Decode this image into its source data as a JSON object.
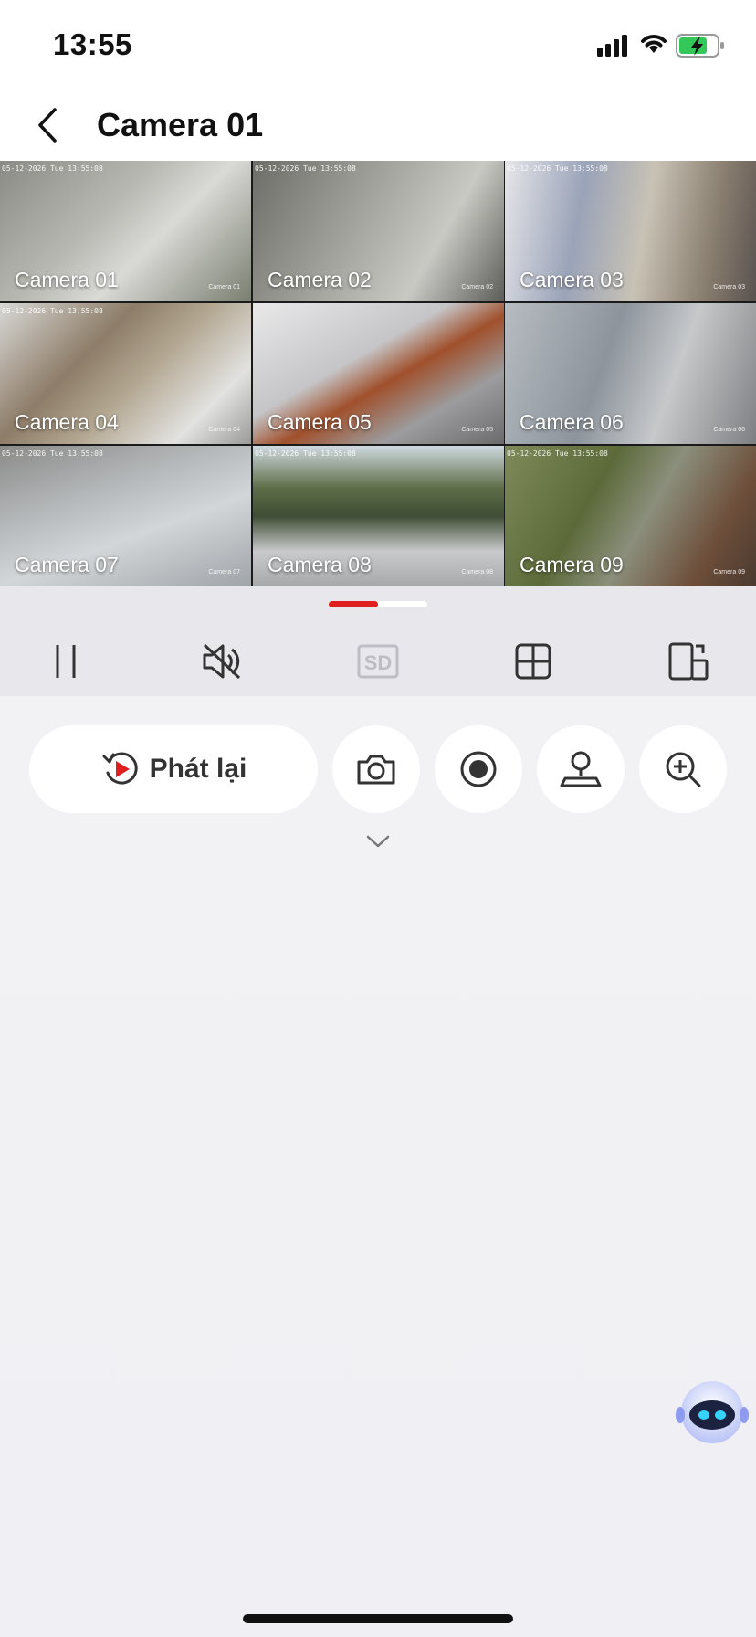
{
  "status_bar": {
    "time": "13:55"
  },
  "header": {
    "title": "Camera 01"
  },
  "cameras": [
    {
      "label": "Camera 01",
      "timestamp": "05-12-2026 Tue 13:55:08",
      "osd": "Camera 01",
      "selected": true
    },
    {
      "label": "Camera 02",
      "timestamp": "05-12-2026 Tue 13:55:08",
      "osd": "Camera 02",
      "selected": false
    },
    {
      "label": "Camera 03",
      "timestamp": "05-12-2026 Tue 13:55:08",
      "osd": "Camera 03",
      "selected": false
    },
    {
      "label": "Camera 04",
      "timestamp": "05-12-2026 Tue 13:55:08",
      "osd": "Camera 04",
      "selected": false
    },
    {
      "label": "Camera 05",
      "timestamp": "",
      "osd": "Camera 05",
      "selected": false
    },
    {
      "label": "Camera 06",
      "timestamp": "",
      "osd": "Camera 06",
      "selected": false
    },
    {
      "label": "Camera 07",
      "timestamp": "05-12-2026 Tue 13:55:08",
      "osd": "Camera 07",
      "selected": false
    },
    {
      "label": "Camera 08",
      "timestamp": "05-12-2026 Tue 13:55:08",
      "osd": "Camera 08",
      "selected": false
    },
    {
      "label": "Camera 09",
      "timestamp": "05-12-2026 Tue 13:55:08",
      "osd": "Camera 09",
      "selected": false
    }
  ],
  "page_indicator": {
    "current": 1,
    "total": 2
  },
  "controls": {
    "quality_label": "SD",
    "icons": [
      "pause-icon",
      "mute-icon",
      "sd-quality-icon",
      "grid-layout-icon",
      "rotate-screen-icon"
    ]
  },
  "actions": {
    "playback_label": "Phát lại",
    "icons": [
      "snapshot-icon",
      "record-icon",
      "ptz-icon",
      "zoom-icon"
    ]
  },
  "colors": {
    "accent": "#e02020",
    "background": "#f1f1f4"
  }
}
